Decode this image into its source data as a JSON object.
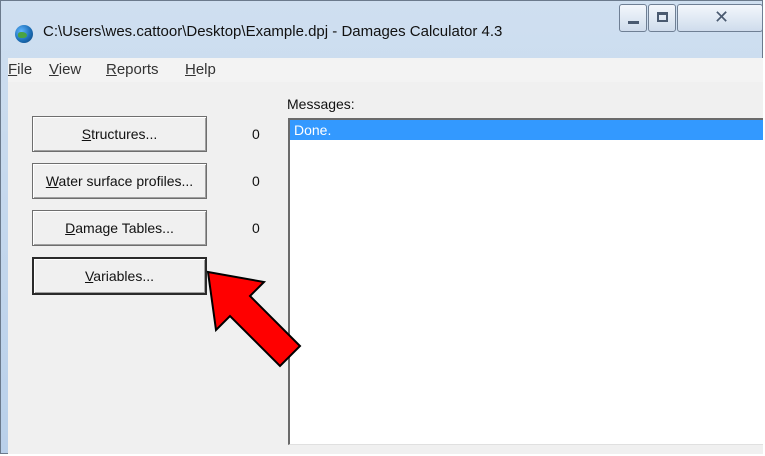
{
  "window": {
    "title": "C:\\Users\\wes.cattoor\\Desktop\\Example.dpj - Damages Calculator 4.3",
    "app_icon": "globe-icon"
  },
  "title_controls": {
    "minimize": "minimize-icon",
    "maximize": "maximize-icon",
    "close": "close-icon"
  },
  "menu": [
    {
      "mnemonic": "F",
      "rest": "ile"
    },
    {
      "mnemonic": "V",
      "rest": "iew"
    },
    {
      "mnemonic": "R",
      "rest": "eports"
    },
    {
      "mnemonic": "H",
      "rest": "elp"
    }
  ],
  "buttons": [
    {
      "pre": "",
      "mnemonic": "S",
      "rest": "tructures...",
      "count": "0"
    },
    {
      "pre": "",
      "mnemonic": "W",
      "rest": "ater surface profiles...",
      "count": "0"
    },
    {
      "pre": "",
      "mnemonic": "D",
      "rest": "amage Tables...",
      "count": "0"
    },
    {
      "pre": "",
      "mnemonic": "V",
      "rest": "ariables..."
    }
  ],
  "messages": {
    "label": "Messages:",
    "items": [
      "Done."
    ]
  },
  "annotation": {
    "arrow_color": "#ff0000",
    "arrow_icon": "red-arrow-icon"
  }
}
